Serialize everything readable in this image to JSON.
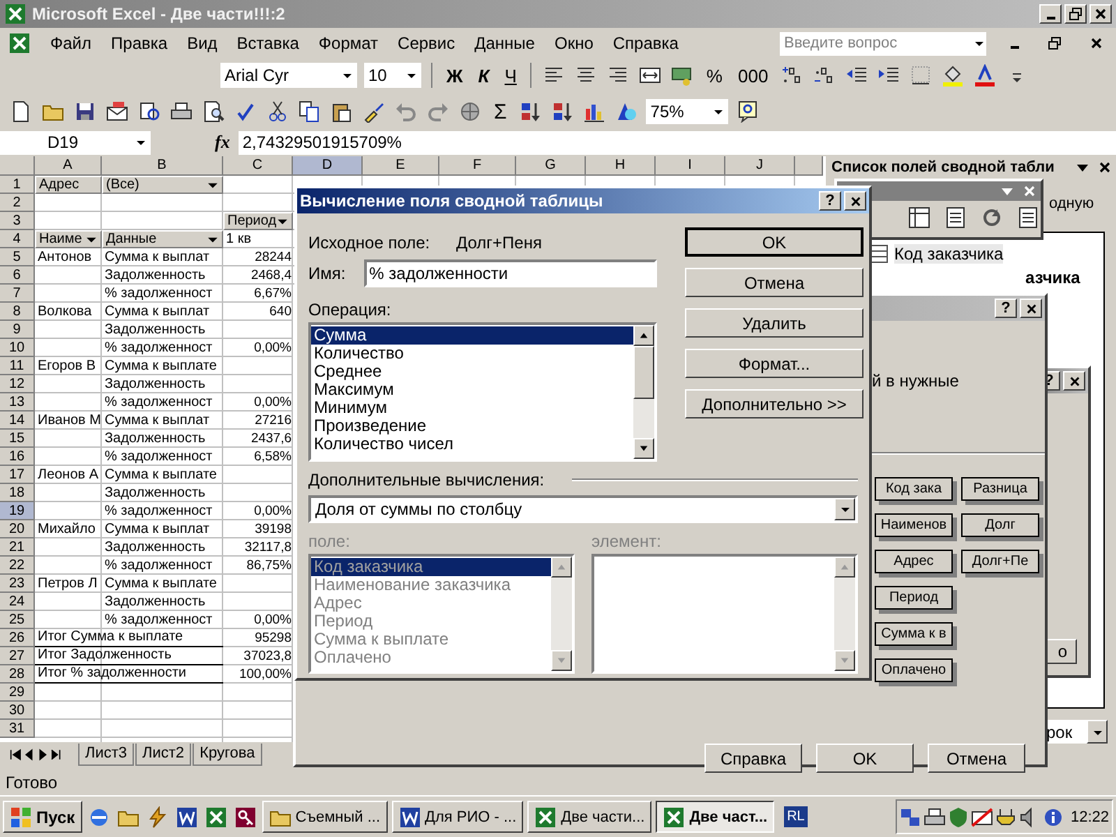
{
  "window": {
    "title": "Microsoft Excel - Две части!!!:2"
  },
  "menu": [
    "Файл",
    "Правка",
    "Вид",
    "Вставка",
    "Формат",
    "Сервис",
    "Данные",
    "Окно",
    "Справка"
  ],
  "help_search": {
    "placeholder": "Введите вопрос"
  },
  "formatting_toolbar": {
    "font": "Arial Cyr",
    "size": "10",
    "style_buttons": [
      "Ж",
      "К",
      "Ч"
    ],
    "number_buttons": [
      "%",
      "000"
    ]
  },
  "standard_toolbar": {
    "sum": "Σ",
    "zoom": "75%"
  },
  "formula_bar": {
    "cell": "D19",
    "fx": "fx",
    "value": "2,74329501915709%"
  },
  "sheet": {
    "columns": [
      {
        "label": "A",
        "selected": false
      },
      {
        "label": "B",
        "selected": false
      },
      {
        "label": "C",
        "selected": false
      },
      {
        "label": "D",
        "selected": true
      },
      {
        "label": "E",
        "selected": false
      },
      {
        "label": "F",
        "selected": false
      },
      {
        "label": "G",
        "selected": false
      },
      {
        "label": "H",
        "selected": false
      },
      {
        "label": "I",
        "selected": false
      },
      {
        "label": "J",
        "selected": false
      }
    ],
    "rows": [
      {
        "number": "1",
        "selected": false,
        "cells": [
          {
            "text": "Адрес",
            "kind": "field"
          },
          {
            "text": "(Все)",
            "kind": "dropdown"
          }
        ]
      },
      {
        "number": "2",
        "selected": false
      },
      {
        "number": "3",
        "selected": false,
        "cells": [
          null,
          null,
          {
            "text": "Период",
            "kind": "dropdown"
          }
        ]
      },
      {
        "number": "4",
        "selected": false,
        "cells": [
          {
            "text": "Наиме",
            "kind": "dropdown"
          },
          {
            "text": "Данные",
            "kind": "dropdown"
          },
          {
            "text": "1 кв",
            "kind": "label"
          }
        ]
      },
      {
        "number": "5",
        "selected": false,
        "cells": [
          {
            "text": "Антонов",
            "kind": "label"
          },
          {
            "text": "Сумма к выплат",
            "kind": "label"
          },
          {
            "text": "28244",
            "kind": "number"
          }
        ]
      },
      {
        "number": "6",
        "selected": false,
        "cells": [
          null,
          {
            "text": "Задолженность",
            "kind": "label"
          },
          {
            "text": "2468,4",
            "kind": "number"
          }
        ]
      },
      {
        "number": "7",
        "selected": false,
        "cells": [
          null,
          {
            "text": "% задолженност",
            "kind": "label"
          },
          {
            "text": "6,67%",
            "kind": "number"
          }
        ]
      },
      {
        "number": "8",
        "selected": false,
        "cells": [
          {
            "text": "Волкова",
            "kind": "label"
          },
          {
            "text": "Сумма к выплат",
            "kind": "label"
          },
          {
            "text": "640",
            "kind": "number"
          }
        ]
      },
      {
        "number": "9",
        "selected": false,
        "cells": [
          null,
          {
            "text": "Задолженность",
            "kind": "label"
          }
        ]
      },
      {
        "number": "10",
        "selected": false,
        "cells": [
          null,
          {
            "text": "% задолженност",
            "kind": "label"
          },
          {
            "text": "0,00%",
            "kind": "number"
          }
        ]
      },
      {
        "number": "11",
        "selected": false,
        "cells": [
          {
            "text": "Егоров В",
            "kind": "label"
          },
          {
            "text": "Сумма к выплате",
            "kind": "label"
          }
        ]
      },
      {
        "number": "12",
        "selected": false,
        "cells": [
          null,
          {
            "text": "Задолженность",
            "kind": "label"
          }
        ]
      },
      {
        "number": "13",
        "selected": false,
        "cells": [
          null,
          {
            "text": "% задолженност",
            "kind": "label"
          },
          {
            "text": "0,00%",
            "kind": "number"
          }
        ]
      },
      {
        "number": "14",
        "selected": false,
        "cells": [
          {
            "text": "Иванов М",
            "kind": "label"
          },
          {
            "text": "Сумма к выплат",
            "kind": "label"
          },
          {
            "text": "27216",
            "kind": "number"
          }
        ]
      },
      {
        "number": "15",
        "selected": false,
        "cells": [
          null,
          {
            "text": "Задолженность",
            "kind": "label"
          },
          {
            "text": "2437,6",
            "kind": "number"
          }
        ]
      },
      {
        "number": "16",
        "selected": false,
        "cells": [
          null,
          {
            "text": "% задолженност",
            "kind": "label"
          },
          {
            "text": "6,58%",
            "kind": "number"
          }
        ]
      },
      {
        "number": "17",
        "selected": false,
        "cells": [
          {
            "text": "Леонов А",
            "kind": "label"
          },
          {
            "text": "Сумма к выплате",
            "kind": "label"
          }
        ]
      },
      {
        "number": "18",
        "selected": false,
        "cells": [
          null,
          {
            "text": "Задолженность",
            "kind": "label"
          }
        ]
      },
      {
        "number": "19",
        "selected": true,
        "cells": [
          null,
          {
            "text": "% задолженност",
            "kind": "label"
          },
          {
            "text": "0,00%",
            "kind": "number"
          }
        ]
      },
      {
        "number": "20",
        "selected": false,
        "cells": [
          {
            "text": "Михайло",
            "kind": "label"
          },
          {
            "text": "Сумма к выплат",
            "kind": "label"
          },
          {
            "text": "39198",
            "kind": "number"
          }
        ]
      },
      {
        "number": "21",
        "selected": false,
        "cells": [
          null,
          {
            "text": "Задолженность",
            "kind": "label"
          },
          {
            "text": "32117,8",
            "kind": "number"
          }
        ]
      },
      {
        "number": "22",
        "selected": false,
        "cells": [
          null,
          {
            "text": "% задолженност",
            "kind": "label"
          },
          {
            "text": "86,75%",
            "kind": "number"
          }
        ]
      },
      {
        "number": "23",
        "selected": false,
        "cells": [
          {
            "text": "Петров Л",
            "kind": "label"
          },
          {
            "text": "Сумма к выплате",
            "kind": "label"
          }
        ]
      },
      {
        "number": "24",
        "selected": false,
        "cells": [
          null,
          {
            "text": "Задолженность",
            "kind": "label"
          }
        ]
      },
      {
        "number": "25",
        "selected": false,
        "cells": [
          null,
          {
            "text": "% задолженност",
            "kind": "label"
          },
          {
            "text": "0,00%",
            "kind": "number"
          }
        ]
      },
      {
        "number": "26",
        "selected": false,
        "cells": [
          {
            "text": "Итог Сумма к выплате",
            "kind": "total"
          },
          {
            "text": "95298",
            "kind": "number"
          }
        ]
      },
      {
        "number": "27",
        "selected": false,
        "cells": [
          {
            "text": "Итог Задолженность",
            "kind": "total"
          },
          {
            "text": "37023,8",
            "kind": "number"
          }
        ]
      },
      {
        "number": "28",
        "selected": false,
        "cells": [
          {
            "text": "Итог % задолженности",
            "kind": "total"
          },
          {
            "text": "100,00%",
            "kind": "number"
          }
        ]
      },
      {
        "number": "29",
        "selected": false
      },
      {
        "number": "30",
        "selected": false
      },
      {
        "number": "31",
        "selected": false
      }
    ],
    "tabs": [
      {
        "label": "Лист3",
        "selected": false
      },
      {
        "label": "Лист2",
        "selected": false
      },
      {
        "label": "Кругова",
        "selected": false
      }
    ]
  },
  "status_bar": {
    "text": "Готово"
  },
  "field_list": {
    "title": "Список полей сводной табли",
    "hint": "одную",
    "items": [
      {
        "label": "Код заказчика",
        "kind": "plain",
        "selected": true
      },
      {
        "label": "азчика",
        "kind": "covered",
        "selected": false
      }
    ],
    "area_combo": "рок"
  },
  "calc_dialog": {
    "title": "Вычисление поля сводной таблицы",
    "help": "?",
    "source_label": "Исходное поле:",
    "source_value": "Долг+Пеня",
    "name_label": "Имя:",
    "name_value": "% задолженности",
    "operation_label": "Операция:",
    "operations": [
      {
        "label": "Сумма",
        "selected": true
      },
      {
        "label": "Количество",
        "selected": false
      },
      {
        "label": "Среднее",
        "selected": false
      },
      {
        "label": "Максимум",
        "selected": false
      },
      {
        "label": "Минимум",
        "selected": false
      },
      {
        "label": "Произведение",
        "selected": false
      },
      {
        "label": "Количество чисел",
        "selected": false
      }
    ],
    "buttons": [
      "OK",
      "Отмена",
      "Удалить",
      "Формат...",
      "Дополнительно >>"
    ],
    "extra_label": "Дополнительные вычисления:",
    "extra_value": "Доля от суммы по столбцу",
    "base": {
      "disabled": true,
      "field_label": "поле:",
      "item_label": "элемент:",
      "fields": [
        {
          "label": "Код заказчика",
          "selected": true
        },
        {
          "label": "Наименование заказчика",
          "selected": false
        },
        {
          "label": "Адрес",
          "selected": false
        },
        {
          "label": "Период",
          "selected": false
        },
        {
          "label": "Сумма к выплате",
          "selected": false
        },
        {
          "label": "Оплачено",
          "selected": false
        }
      ]
    }
  },
  "layout_dialog": {
    "help": "?",
    "hint": "й в нужные",
    "fields": [
      "Код зака",
      "Наименов",
      "Адрес",
      "Период",
      "Сумма к в",
      "Оплачено",
      "Разница",
      "Долг",
      "Долг+Пе"
    ],
    "buttons": [
      "Справка",
      "OK",
      "Отмена"
    ]
  },
  "back_dialog": {
    "help": "?",
    "button": "о"
  },
  "taskbar": {
    "start": "Пуск",
    "tasks": [
      {
        "label": "Съемный ...",
        "kind": "folder",
        "selected": false
      },
      {
        "label": "Для РИО - ...",
        "kind": "word",
        "selected": false
      },
      {
        "label": "Две части...",
        "kind": "excel",
        "selected": false
      },
      {
        "label": "Две част...",
        "kind": "excel",
        "selected": true
      }
    ],
    "tray_label": "RL",
    "clock": "12:22"
  }
}
